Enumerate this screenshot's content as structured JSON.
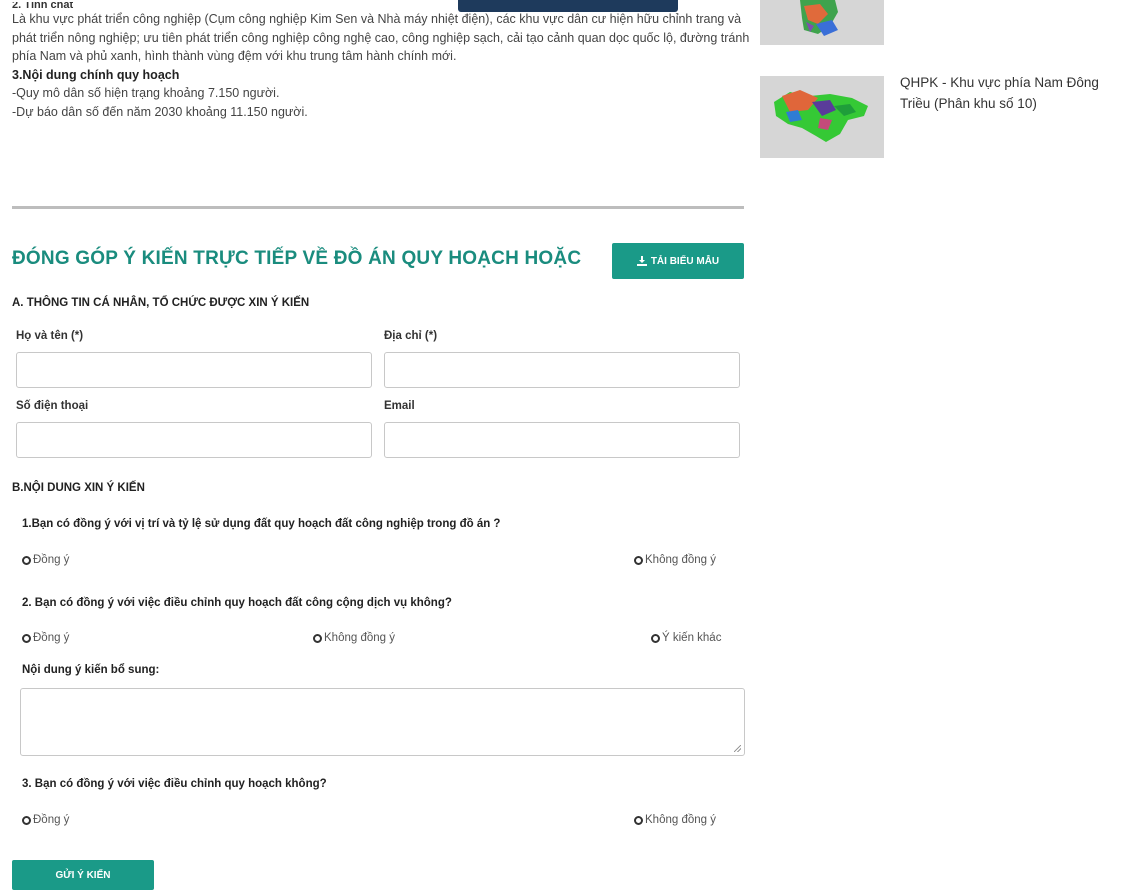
{
  "intro": {
    "heading_cut": "2. Tính chất",
    "paragraph": "Là khu vực phát triển công nghiệp (Cụm công nghiệp Kim Sen và Nhà máy nhiệt điện), các khu vực dân cư hiện hữu chỉnh trang và phát triển nông nghiệp; ưu tiên phát triển công nghiệp công nghệ cao, công nghiệp sạch, cải tạo cảnh quan dọc quốc lộ, đường tránh phía Nam và phủ xanh, hình thành vùng đệm với khu trung tâm hành chính mới.",
    "section3_heading": "3.Nội dung chính quy hoạch",
    "population_current": "-Quy mô dân số hiện trạng khoảng 7.150 người.",
    "population_forecast": "-Dự báo dân số đến năm 2030 khoảng 11.150 người."
  },
  "form": {
    "title": "ĐÓNG GÓP Ý KIẾN TRỰC TIẾP VỀ ĐỒ ÁN QUY HOẠCH HOẶC",
    "download_label": "TẢI BIỂU MẪU",
    "section_a": "A. THÔNG TIN CÁ NHÂN, TỔ CHỨC ĐƯỢC XIN Ý KIẾN",
    "fields": {
      "name_label": "Họ và tên (*)",
      "address_label": "Địa chỉ (*)",
      "phone_label": "Số điện thoại",
      "email_label": "Email"
    },
    "section_b": "B.NỘI DUNG XIN Ý KIẾN",
    "q1": "1.Bạn có đồng ý với vị trí và tỷ lệ sử dụng đất quy hoạch đất công nghiệp trong đồ án ?",
    "q2": "2. Bạn có đồng ý với việc điều chỉnh quy hoạch đất công cộng dịch vụ không?",
    "q3": "3. Bạn có đồng ý với việc điều chỉnh quy hoạch không?",
    "opt_agree": "Đồng ý",
    "opt_disagree": "Không đồng ý",
    "opt_other": "Ý kiến khác",
    "extra_label": "Nội dung ý kiến bổ sung:",
    "submit_label": "GỬI Ý KIẾN",
    "accent_color": "#1a9a88"
  },
  "sidebar": {
    "items": [
      {
        "title": ""
      },
      {
        "title": "QHPK - Khu vực phía Nam Đông Triều (Phân khu số 10)"
      }
    ]
  }
}
